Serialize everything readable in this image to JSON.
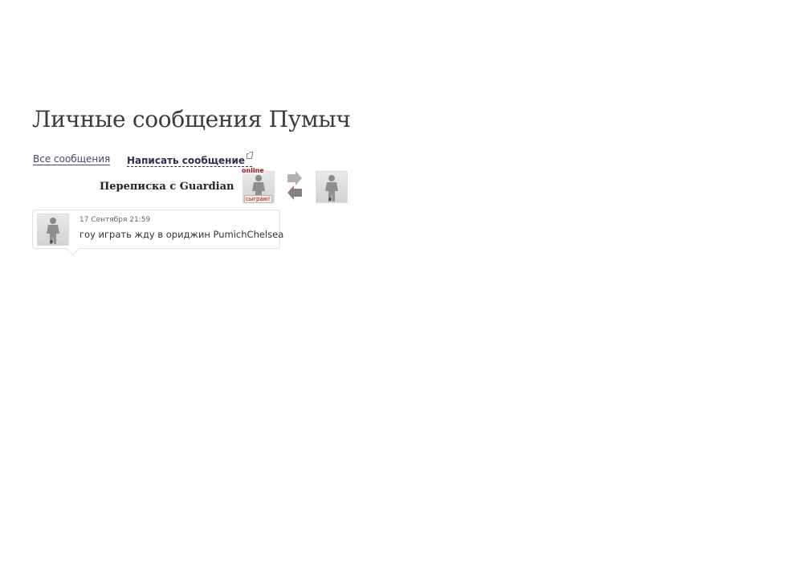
{
  "page": {
    "title": "Личные сообщения Пумыч"
  },
  "nav": {
    "all_messages": "Все сообщения",
    "write_message": "Написать сообщение"
  },
  "dialog": {
    "header": "Переписка с Guardian",
    "partner_status": "online",
    "partner_badge": "сыграю!",
    "icons": {
      "partner_avatar": "player-silhouette-avatar",
      "swap": "swap-arrows-icon",
      "own_avatar": "player-silhouette-avatar"
    }
  },
  "messages": [
    {
      "date": "17 Сентября 21:59",
      "text": "гоу играть жду в ориджин PumichChelsea"
    }
  ],
  "colors": {
    "link": "#44466a",
    "status_red": "#a01010",
    "card_border": "#e2e2e2"
  }
}
